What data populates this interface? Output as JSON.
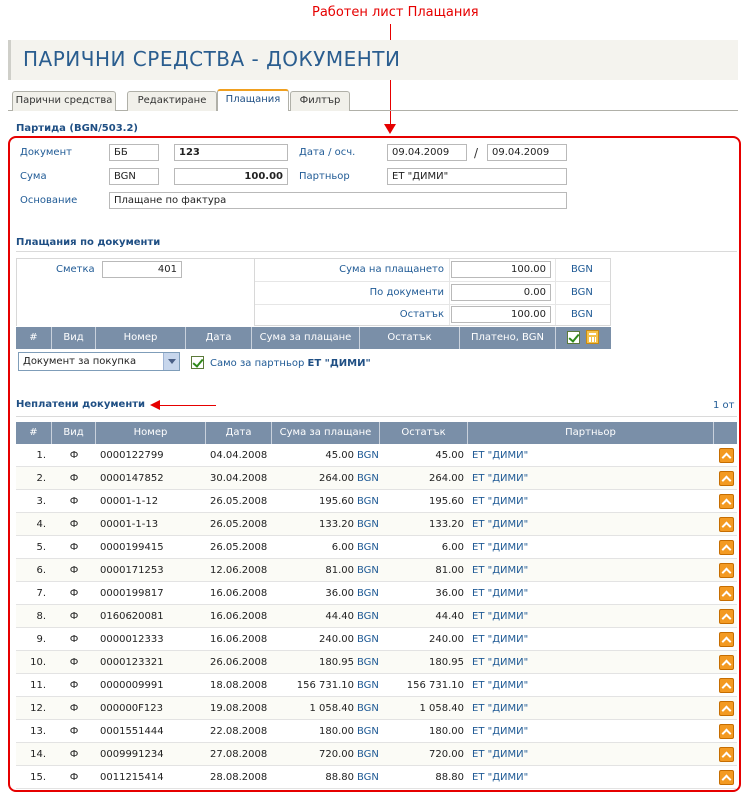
{
  "annotation": {
    "title": "Работен лист Плащания"
  },
  "page": {
    "title": "ПАРИЧНИ СРЕДСТВА - ДОКУМЕНТИ"
  },
  "tabs": [
    {
      "label": "Парични средства"
    },
    {
      "label": "Редактиране"
    },
    {
      "label": "Плащания"
    },
    {
      "label": "Филтър"
    }
  ],
  "batch": {
    "title": "Партида (BGN/503.2)"
  },
  "document": {
    "doc_label": "Документ",
    "doc_type": "ББ",
    "doc_number": "123",
    "date_label": "Дата / осч.",
    "date": "09.04.2009",
    "date_sep": "/",
    "posting_date": "09.04.2009",
    "amount_label": "Сума",
    "currency": "BGN",
    "amount": "100.00",
    "partner_label": "Партньор",
    "partner": "ЕТ \"ДИМИ\"",
    "basis_label": "Основание",
    "basis": "Плащане по фактура"
  },
  "payments": {
    "title": "Плащания по документи",
    "account_label": "Сметка",
    "account": "401",
    "payment_amount_label": "Сума на плащането",
    "payment_amount": "100.00",
    "payment_currency": "BGN",
    "by_docs_label": "По документи",
    "by_docs": "0.00",
    "by_docs_currency": "BGN",
    "remainder_label": "Остатък",
    "remainder": "100.00",
    "remainder_currency": "BGN",
    "columns": [
      "#",
      "Вид",
      "Номер",
      "Дата",
      "Сума за плащане",
      "Остатък",
      "Платено, BGN"
    ],
    "doc_type_select": "Документ за покупка",
    "partner_only_label": "Само за партньор",
    "partner_only_name": "ЕТ \"ДИМИ\""
  },
  "unpaid": {
    "title": "Неплатени документи",
    "page_info": "1 от",
    "columns": [
      "#",
      "Вид",
      "Номер",
      "Дата",
      "Сума за плащане",
      "Остатък",
      "Партньор"
    ],
    "currency": "BGN",
    "rows": [
      {
        "n": "1.",
        "type": "Ф",
        "number": "0000122799",
        "date": "04.04.2008",
        "amount": "45.00",
        "remainder": "45.00",
        "partner": "ЕТ \"ДИМИ\""
      },
      {
        "n": "2.",
        "type": "Ф",
        "number": "0000147852",
        "date": "30.04.2008",
        "amount": "264.00",
        "remainder": "264.00",
        "partner": "ЕТ \"ДИМИ\""
      },
      {
        "n": "3.",
        "type": "Ф",
        "number": "00001-1-12",
        "date": "26.05.2008",
        "amount": "195.60",
        "remainder": "195.60",
        "partner": "ЕТ \"ДИМИ\""
      },
      {
        "n": "4.",
        "type": "Ф",
        "number": "00001-1-13",
        "date": "26.05.2008",
        "amount": "133.20",
        "remainder": "133.20",
        "partner": "ЕТ \"ДИМИ\""
      },
      {
        "n": "5.",
        "type": "Ф",
        "number": "0000199415",
        "date": "26.05.2008",
        "amount": "6.00",
        "remainder": "6.00",
        "partner": "ЕТ \"ДИМИ\""
      },
      {
        "n": "6.",
        "type": "Ф",
        "number": "0000171253",
        "date": "12.06.2008",
        "amount": "81.00",
        "remainder": "81.00",
        "partner": "ЕТ \"ДИМИ\""
      },
      {
        "n": "7.",
        "type": "Ф",
        "number": "0000199817",
        "date": "16.06.2008",
        "amount": "36.00",
        "remainder": "36.00",
        "partner": "ЕТ \"ДИМИ\""
      },
      {
        "n": "8.",
        "type": "Ф",
        "number": "0160620081",
        "date": "16.06.2008",
        "amount": "44.40",
        "remainder": "44.40",
        "partner": "ЕТ \"ДИМИ\""
      },
      {
        "n": "9.",
        "type": "Ф",
        "number": "0000012333",
        "date": "16.06.2008",
        "amount": "240.00",
        "remainder": "240.00",
        "partner": "ЕТ \"ДИМИ\""
      },
      {
        "n": "10.",
        "type": "Ф",
        "number": "0000123321",
        "date": "26.06.2008",
        "amount": "180.95",
        "remainder": "180.95",
        "partner": "ЕТ \"ДИМИ\""
      },
      {
        "n": "11.",
        "type": "Ф",
        "number": "0000009991",
        "date": "18.08.2008",
        "amount": "156 731.10",
        "remainder": "156 731.10",
        "partner": "ЕТ \"ДИМИ\""
      },
      {
        "n": "12.",
        "type": "Ф",
        "number": "000000F123",
        "date": "19.08.2008",
        "amount": "1 058.40",
        "remainder": "1 058.40",
        "partner": "ЕТ \"ДИМИ\""
      },
      {
        "n": "13.",
        "type": "Ф",
        "number": "0001551444",
        "date": "22.08.2008",
        "amount": "180.00",
        "remainder": "180.00",
        "partner": "ЕТ \"ДИМИ\""
      },
      {
        "n": "14.",
        "type": "Ф",
        "number": "0009991234",
        "date": "27.08.2008",
        "amount": "720.00",
        "remainder": "720.00",
        "partner": "ЕТ \"ДИМИ\""
      },
      {
        "n": "15.",
        "type": "Ф",
        "number": "0011215414",
        "date": "28.08.2008",
        "amount": "88.80",
        "remainder": "88.80",
        "partner": "ЕТ \"ДИМИ\""
      }
    ]
  },
  "colors": {
    "accent": "#e60000",
    "header_bg": "#7a8fa8",
    "link": "#1f5a95",
    "title": "#2a5d8f"
  }
}
